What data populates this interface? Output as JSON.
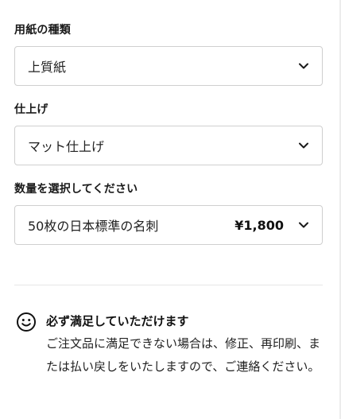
{
  "paper": {
    "label": "用紙の種類",
    "selected": "上質紙"
  },
  "finish": {
    "label": "仕上げ",
    "selected": "マット仕上げ"
  },
  "quantity": {
    "label": "数量を選択してください",
    "selected": "50枚の日本標準の名刺",
    "price": "¥1,800"
  },
  "guarantee": {
    "icon": "smile-icon",
    "title": "必ず満足していただけます",
    "body": "ご注文品に満足できない場合は、修正、再印刷、または払い戻しをいたしますので、ご連絡ください。"
  }
}
